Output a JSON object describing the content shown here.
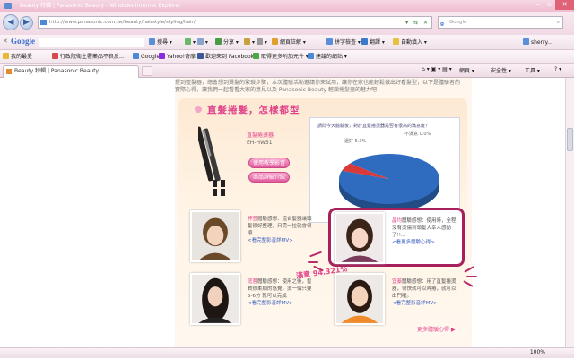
{
  "window": {
    "title": "Beauty 特輯 | Panasonic Beauty - Windows Internet Explorer"
  },
  "nav": {
    "address": "http://www.panasonic.com.tw/beauty/hairstyle/styling/hair/",
    "search_placeholder": "Google"
  },
  "gbar": {
    "logo": "Google",
    "items": [
      "搜尋",
      "分享",
      "網頁註解",
      "拼字檢查",
      "翻譯",
      "自動填入"
    ],
    "user": "sherry..."
  },
  "favorites": {
    "label": "我的最愛",
    "items": [
      "行政院衛生署藥品不良反...",
      "Google",
      "Yahoo!奇摩",
      "歡迎來到 Facebook",
      "取得更多附加元件",
      "建議的網站"
    ]
  },
  "tab": {
    "label": "Beauty 特輯 | Panasonic Beauty"
  },
  "commands": {
    "page": "網頁",
    "safety": "安全性",
    "tools": "工具"
  },
  "page": {
    "intro": "提到整髮器，總會想到燙髮的繁瑣步驟，本次體驗活動邀請你來試用，讓你在家也能輕鬆做出好看髮型，以下是體驗者的實際心得，讓我們一起看看大家的意見以及 Panasonic Beauty 輕鎖捲髮器的魅力吧！",
    "heading": "直髮捲髮，怎樣都型",
    "product": {
      "name": "直髮捲燙器",
      "model": "EH-HW51",
      "btn_video": "使用教學影音",
      "btn_detail": "商品詳細介紹"
    },
    "poll": {
      "question": "請問今天體驗後，對於直髮捲燙器是否有很高的滿意度？",
      "option_yes": "滿意 94.7%",
      "option_mid": "還好 5.3%",
      "option_no": "不滿意 0.0%"
    },
    "satisfaction": "滿意 94.321%",
    "reviews": [
      {
        "name": "梓萱",
        "text": "體驗感想：這台髮器讓頭髮很好整理，只需一拉就會很順...",
        "link": "<看完整影音詳MV>"
      },
      {
        "name": "晶均",
        "text": "體驗感想：使用時，全程沒有燙傷到頭髮大幸人感動了!!...",
        "link": "<看更多體驗心得>"
      },
      {
        "name": "庭蓉",
        "text": "體驗感想：使用之後，髮質很柔順的感覺，燙一個只要5-6分 就可以完成",
        "link": "<看完整影音詳MV>"
      },
      {
        "name": "宜蓁",
        "text": "體驗感想：用了直髮捲燙器，很快就可以弄捲，就可以出門喔。",
        "link": "<看完整影音詳MV>"
      }
    ],
    "more": "更多體驗心得 ▶"
  },
  "chart_data": {
    "type": "pie",
    "categories": [
      "滿意",
      "還好",
      "不滿意"
    ],
    "values": [
      94.7,
      5.3,
      0.0
    ],
    "colors": [
      "#2f6cc0",
      "#d83a3a",
      "#7cc04a"
    ]
  },
  "status": {
    "zoom": "100%"
  }
}
